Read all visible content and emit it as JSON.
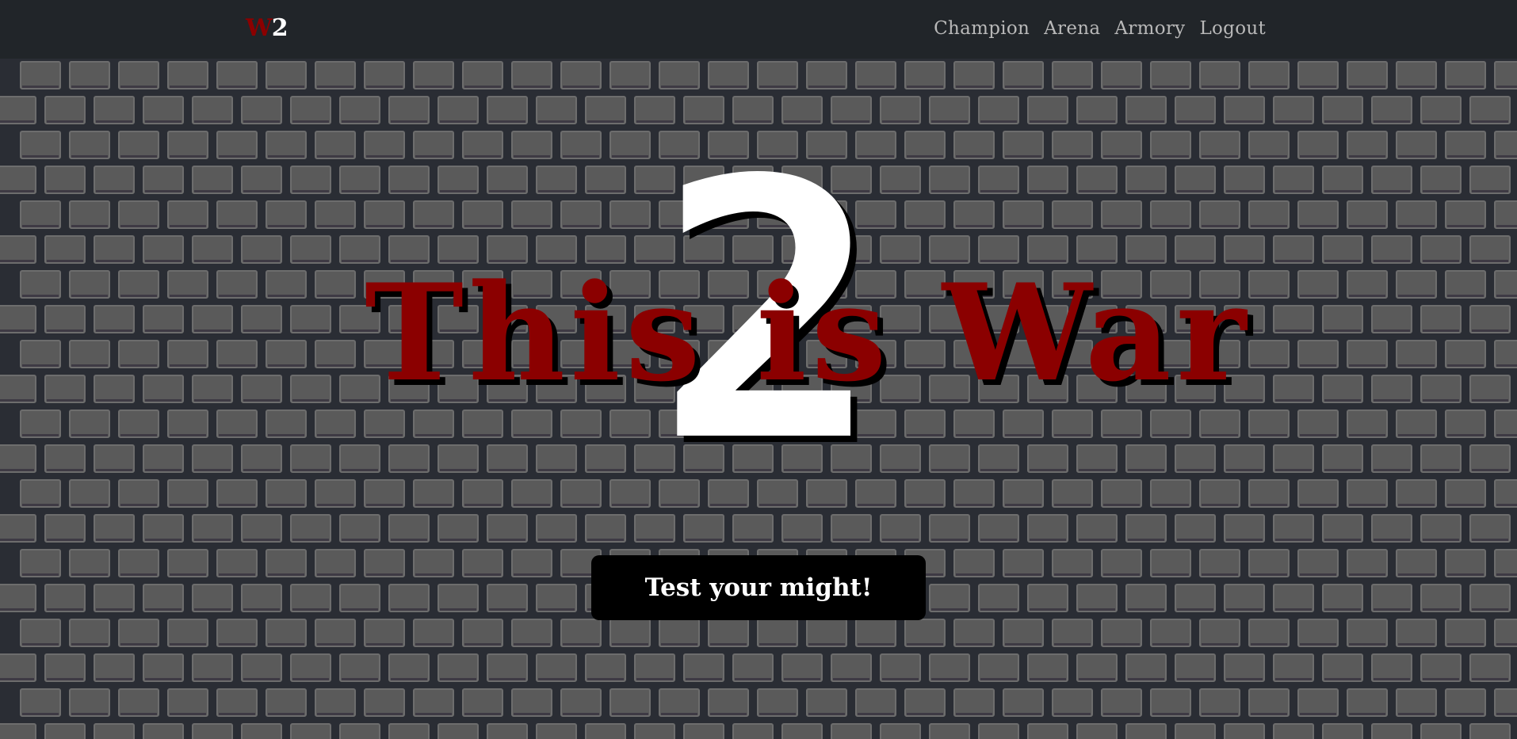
{
  "navbar": {
    "brand_w": "W",
    "brand_two": "2",
    "links": [
      "Champion",
      "Arena",
      "Armory",
      "Logout"
    ]
  },
  "hero": {
    "big_number": "2",
    "title": "This is War",
    "cta_label": "Test your might!"
  },
  "colors": {
    "navbar_bg": "#212529",
    "title_red": "#8b0000",
    "brick": "#5a5a5a",
    "mortar": "#2a2d34",
    "nav_text": "#b8b8b8"
  }
}
